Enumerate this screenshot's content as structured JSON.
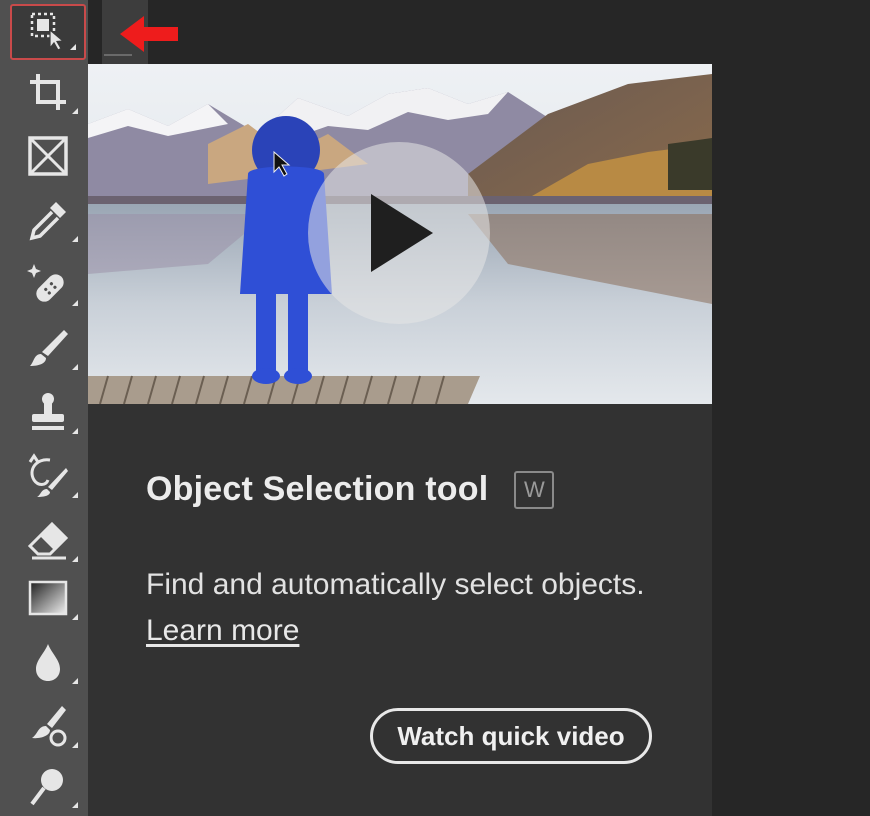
{
  "toolbar": {
    "tools": [
      {
        "icon": "object-selection-icon",
        "active": true
      },
      {
        "icon": "crop-icon"
      },
      {
        "icon": "frame-icon"
      },
      {
        "icon": "eyedropper-icon"
      },
      {
        "icon": "healing-brush-icon"
      },
      {
        "icon": "brush-icon"
      },
      {
        "icon": "clone-stamp-icon"
      },
      {
        "icon": "history-brush-icon"
      },
      {
        "icon": "eraser-icon"
      },
      {
        "icon": "gradient-icon"
      },
      {
        "icon": "blur-icon"
      },
      {
        "icon": "dodge-burn-icon"
      },
      {
        "icon": "dodge-icon"
      }
    ]
  },
  "tooltip": {
    "title": "Object Selection tool",
    "shortcut": "W",
    "description": "Find and automatically select objects.",
    "learn_more": "Learn more",
    "watch_button": "Watch quick video"
  },
  "colors": {
    "toolbar_bg": "#505050",
    "panel_bg": "#323232",
    "page_bg": "#262626",
    "highlight_red": "#ee1c1c",
    "selection_blue": "#2f4fd6"
  }
}
